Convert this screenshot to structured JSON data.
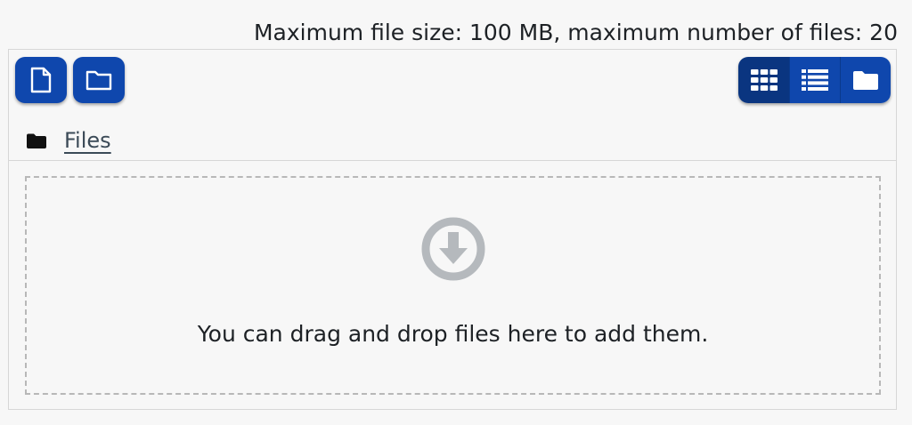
{
  "limits": {
    "text": "Maximum file size: 100 MB, maximum number of files: 20"
  },
  "toolbar": {
    "add_file_icon": "file-icon",
    "create_folder_icon": "folder-outline-icon"
  },
  "view_modes": {
    "active": "icons",
    "items": [
      {
        "id": "icons",
        "icon": "grid-icon"
      },
      {
        "id": "list",
        "icon": "list-icon"
      },
      {
        "id": "tree",
        "icon": "folder-icon"
      }
    ]
  },
  "path": {
    "root_label": "Files"
  },
  "dropzone": {
    "message": "You can drag and drop files here to add them."
  },
  "colors": {
    "button": "#0f47ad",
    "button_active": "#0a3580",
    "background": "#f7f7f7",
    "drop_icon": "#b5b9bd"
  }
}
